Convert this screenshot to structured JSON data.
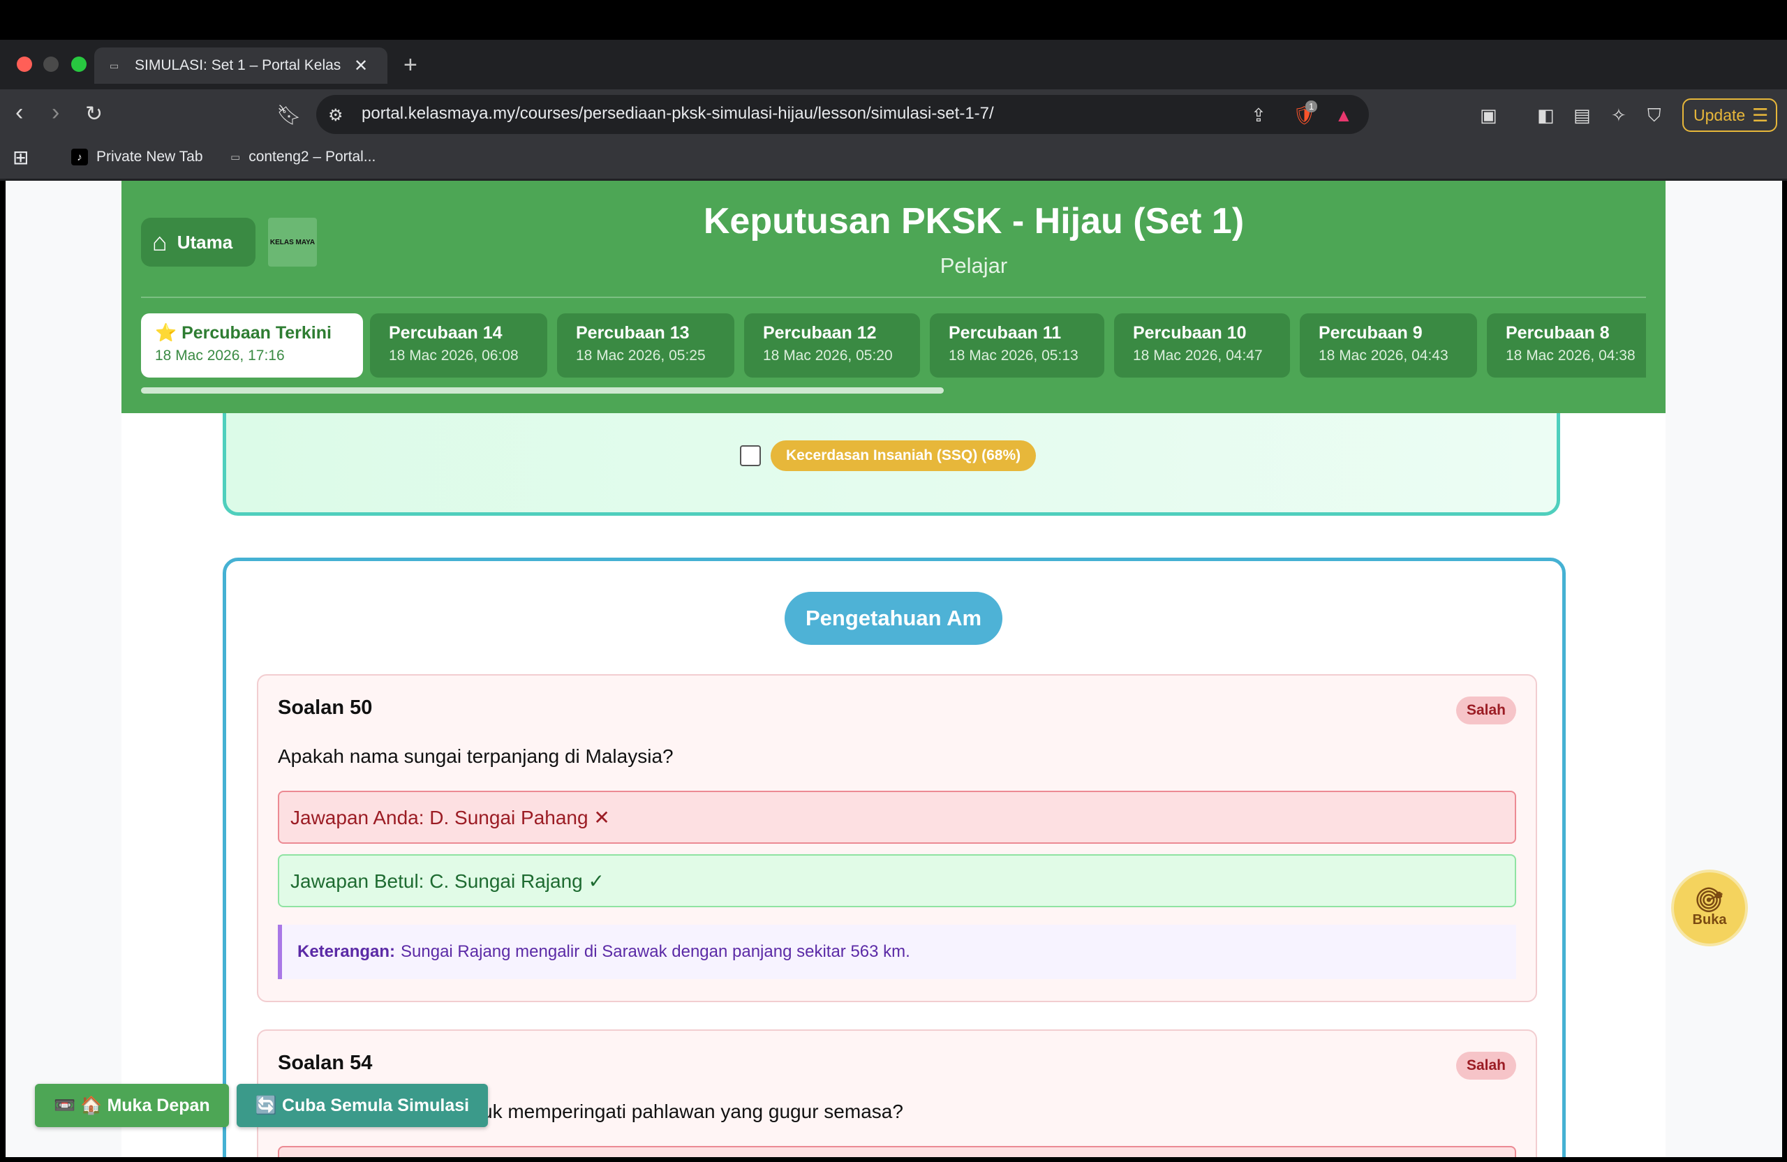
{
  "browser": {
    "tab_title": "SIMULASI: Set 1 – Portal Kelas",
    "new_tab_symbol": "+",
    "close_symbol": "✕",
    "url": "portal.kelasmaya.my/courses/persediaan-pksk-simulasi-hijau/lesson/simulasi-set-1-7/",
    "update_label": "Update",
    "shield_count": "1",
    "bookmarks": [
      "Private New Tab",
      "conteng2 – Portal..."
    ]
  },
  "header": {
    "home_label": "Utama",
    "logo_text": "KELAS MAYA",
    "title": "Keputusan PKSK - Hijau (Set 1)",
    "subtitle": "Pelajar",
    "attempts": [
      {
        "name": "⭐ Percubaan Terkini",
        "date": "18 Mac 2026, 17:16"
      },
      {
        "name": "Percubaan 14",
        "date": "18 Mac 2026, 06:08"
      },
      {
        "name": "Percubaan 13",
        "date": "18 Mac 2026, 05:25"
      },
      {
        "name": "Percubaan 12",
        "date": "18 Mac 2026, 05:20"
      },
      {
        "name": "Percubaan 11",
        "date": "18 Mac 2026, 05:13"
      },
      {
        "name": "Percubaan 10",
        "date": "18 Mac 2026, 04:47"
      },
      {
        "name": "Percubaan 9",
        "date": "18 Mac 2026, 04:43"
      },
      {
        "name": "Percubaan 8",
        "date": "18 Mac 2026, 04:38"
      }
    ]
  },
  "filter": {
    "ssq_label": "Kecerdasan Insaniah (SSQ) (68%)"
  },
  "section": {
    "title": "Pengetahuan Am",
    "questions": [
      {
        "title": "Soalan 50",
        "status": "Salah",
        "question": "Apakah nama sungai terpanjang di Malaysia?",
        "your_answer": "Jawapan Anda: D. Sungai Pahang ✕",
        "correct_answer": "Jawapan Betul: C. Sungai Rajang ✓",
        "note_label": "Keterangan:",
        "note_text": "Sungai Rajang mengalir di Sarawak dengan panjang sekitar 563 km."
      },
      {
        "title": "Soalan 54",
        "status": "Salah",
        "question": "uk memperingati pahlawan yang gugur semasa?"
      }
    ]
  },
  "floating": {
    "home_label": "📼 🏠 Muka Depan",
    "retry_label": "🔄 Cuba Semula Simulasi",
    "open_label": "Buka"
  },
  "colors": {
    "header_green": "#4da655",
    "section_blue": "#45b1d3",
    "wrong_red": "#9b1c24",
    "right_green": "#1e6b31"
  }
}
